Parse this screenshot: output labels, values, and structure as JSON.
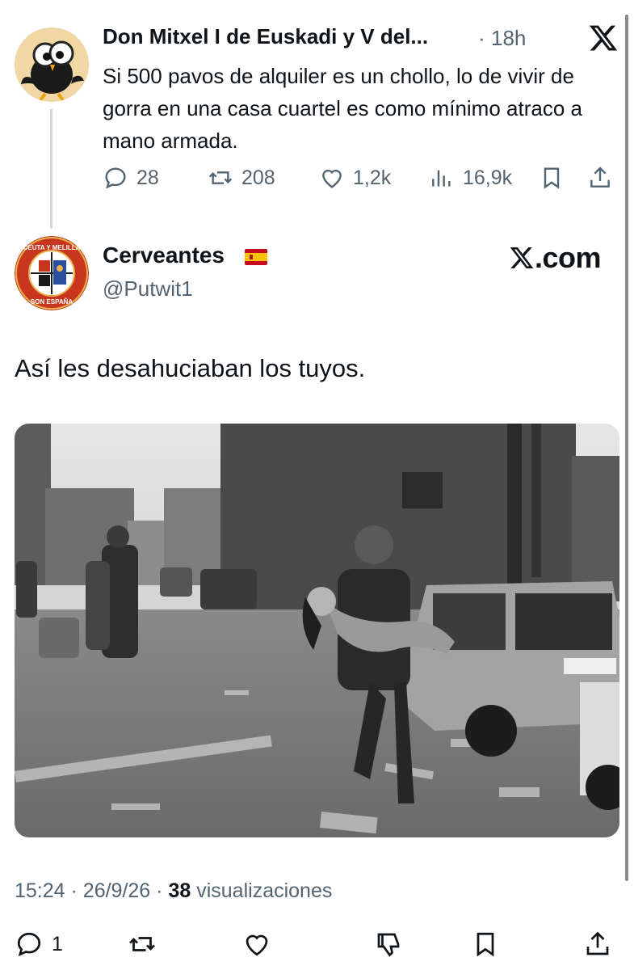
{
  "parent_tweet": {
    "author_name": "Don Mitxel I de Euskadi y V del...",
    "separator": "·",
    "time_ago": "18h",
    "text": "Si 500 pavos de alquiler es un chollo, lo de vivir de gorra en una casa cuartel es como mínimo atraco a mano armada.",
    "replies": "28",
    "retweets": "208",
    "likes": "1,2k",
    "views": "16,9k"
  },
  "quoted_tweet": {
    "author_name": "Cerveantes",
    "handle": "@Putwit1",
    "domain_label": ".com",
    "text": "Así les desahuciaban los tuyos.",
    "avatar_text_top": "CEUTA Y MELILLA",
    "avatar_text_bottom": "SON ESPAÑA",
    "time": "15:24",
    "date": "26/9/26",
    "view_count": "38",
    "views_label": "visualizaciones",
    "replies": "1"
  },
  "colors": {
    "text": "#0f1419",
    "muted": "#536471",
    "thread_line": "#cfd9de"
  }
}
